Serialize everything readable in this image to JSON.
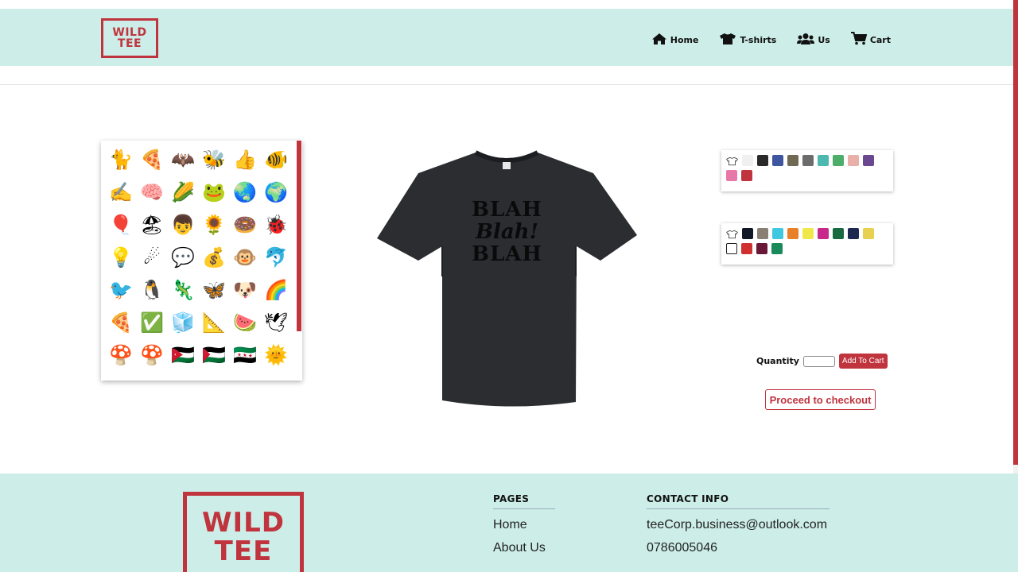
{
  "brand": {
    "logo_line1": "WILD",
    "logo_line2": "TEE",
    "accent_color": "#c0343e",
    "header_bg": "#cdeee8"
  },
  "nav": [
    {
      "label": "Home",
      "icon": "home-icon"
    },
    {
      "label": "T-shirts",
      "icon": "tshirt-icon"
    },
    {
      "label": "Us",
      "icon": "users-icon"
    },
    {
      "label": "Cart",
      "icon": "cart-icon"
    }
  ],
  "stickers": [
    "🐈",
    "🍕",
    "🦇",
    "🐝",
    "👍",
    "🐠",
    "✍",
    "🧠",
    "🌽",
    "🐸",
    "🌏",
    "🌍",
    "🎈",
    "🏖",
    "👦",
    "🌻",
    "🍩",
    "🐞",
    "💡",
    "☄",
    "💬",
    "💰",
    "🐵",
    "🐬",
    "🐦",
    "🐧",
    "🦎",
    "🦋",
    "🐶",
    "🌈",
    "🍕",
    "✅",
    "🧊",
    "📐",
    "🍉",
    "🕊",
    "🍄",
    "🍄",
    "🇯🇴",
    "🇵🇸",
    "🇸🇾",
    "🌞"
  ],
  "product": {
    "print_line1": "BLAH",
    "print_line2": "Blah!",
    "print_line3": "BLAH",
    "shirt_color": "#2b2d31"
  },
  "color_palettes": [
    {
      "colors": [
        "#f0f0f0",
        "#2a2a2a",
        "#3e55a0",
        "#706a55",
        "#6c6c6c",
        "#4db8b0",
        "#4cae6a",
        "#e8b0a8",
        "#6a4890",
        "#e878a8",
        "#c0343e"
      ]
    },
    {
      "colors": [
        "#101828",
        "#8a7f74",
        "#3fc8e0",
        "#e8802a",
        "#f0e84a",
        "#c8288a",
        "#1a6a40",
        "#1c2850",
        "#e8d050",
        "#ffffff",
        "#d03030",
        "#6a1838",
        "#1a8a5a"
      ]
    }
  ],
  "cart": {
    "quantity_label": "Quantity",
    "quantity_value": "",
    "add_button": "Add To Cart",
    "checkout_button": "Proceed to checkout"
  },
  "footer": {
    "pages_heading": "PAGES",
    "pages_links": [
      "Home",
      "About Us"
    ],
    "contact_heading": "CONTACT INFO",
    "email": "teeCorp.business@outlook.com",
    "phone": "0786005046"
  }
}
